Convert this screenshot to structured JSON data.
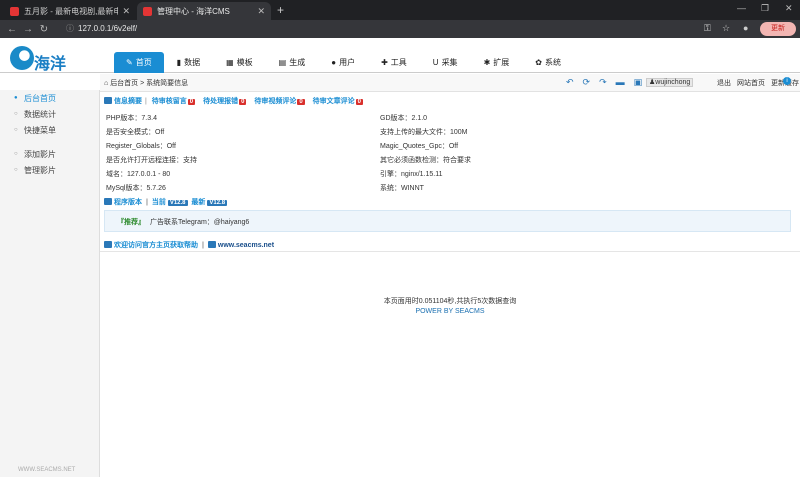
{
  "browser": {
    "tabs": [
      {
        "title": "五月影 - 最新电视剧,最新电影",
        "active": false
      },
      {
        "title": "管理中心 - 海洋CMS",
        "active": true
      }
    ],
    "url": "127.0.0.1/6v2elf/",
    "update_label": "更新"
  },
  "logo": {
    "text": "海洋"
  },
  "nav": [
    {
      "label": "首页",
      "icon": "edit-icon",
      "glyph": "✎",
      "active": true
    },
    {
      "label": "数据",
      "icon": "book-icon",
      "glyph": "▮"
    },
    {
      "label": "模板",
      "icon": "template-icon",
      "glyph": "▦"
    },
    {
      "label": "生成",
      "icon": "file-icon",
      "glyph": "▤"
    },
    {
      "label": "用户",
      "icon": "user-icon",
      "glyph": "●"
    },
    {
      "label": "工具",
      "icon": "wrench-icon",
      "glyph": "✚"
    },
    {
      "label": "采集",
      "icon": "magnet-icon",
      "glyph": "U"
    },
    {
      "label": "扩展",
      "icon": "puzzle-icon",
      "glyph": "✱"
    },
    {
      "label": "系统",
      "icon": "gear-icon",
      "glyph": "✿"
    }
  ],
  "sidebar": {
    "items": [
      {
        "label": "后台首页",
        "active": true
      },
      {
        "label": "数据统计"
      },
      {
        "label": "快捷菜单"
      }
    ],
    "items2": [
      {
        "label": "添加影片"
      },
      {
        "label": "管理影片"
      }
    ],
    "footer": "WWW.SEACMS.NET"
  },
  "crumb": {
    "text": "后台首页 > 系统简要信息",
    "username": "wujinchong",
    "logout": "退出",
    "site_home": "网站首页",
    "refresh_cache": "更新缓存"
  },
  "summary_links": {
    "info": "信息摘要",
    "pending_messages": {
      "label": "待审核留言",
      "count": "0"
    },
    "pending_reports": {
      "label": "待处理报错",
      "count": "0"
    },
    "pending_video_comments": {
      "label": "待审视频评论",
      "count": "0"
    },
    "pending_article_comments": {
      "label": "待审文章评论",
      "count": "0"
    }
  },
  "info": {
    "left": [
      "PHP版本：7.3.4",
      "是否安全模式：Off",
      "Register_Globals：Off",
      "是否允许打开远程连接：支持",
      "域名：127.0.0.1 - 80",
      "MySql版本：5.7.26"
    ],
    "right": [
      "GD版本：2.1.0",
      "支持上传的最大文件：100M",
      "Magic_Quotes_Gpc：Off",
      "其它必须函数检测：符合要求",
      "引擎：nginx/1.15.11",
      "系统：WINNT"
    ]
  },
  "version": {
    "label": "程序版本",
    "current_label": "当前",
    "current": "V12.8",
    "latest_label": "最新",
    "latest": "V12.8"
  },
  "recommend": {
    "tag": "『推荐』",
    "text": "广告联系Telegram：@haiyang6"
  },
  "help": {
    "text": "欢迎访问官方主页获取帮助",
    "link": "www.seacms.net"
  },
  "footer": {
    "runtime": "本页面用时0.051104秒,共执行5次数据查询",
    "powered": "POWER BY SEACMS"
  }
}
